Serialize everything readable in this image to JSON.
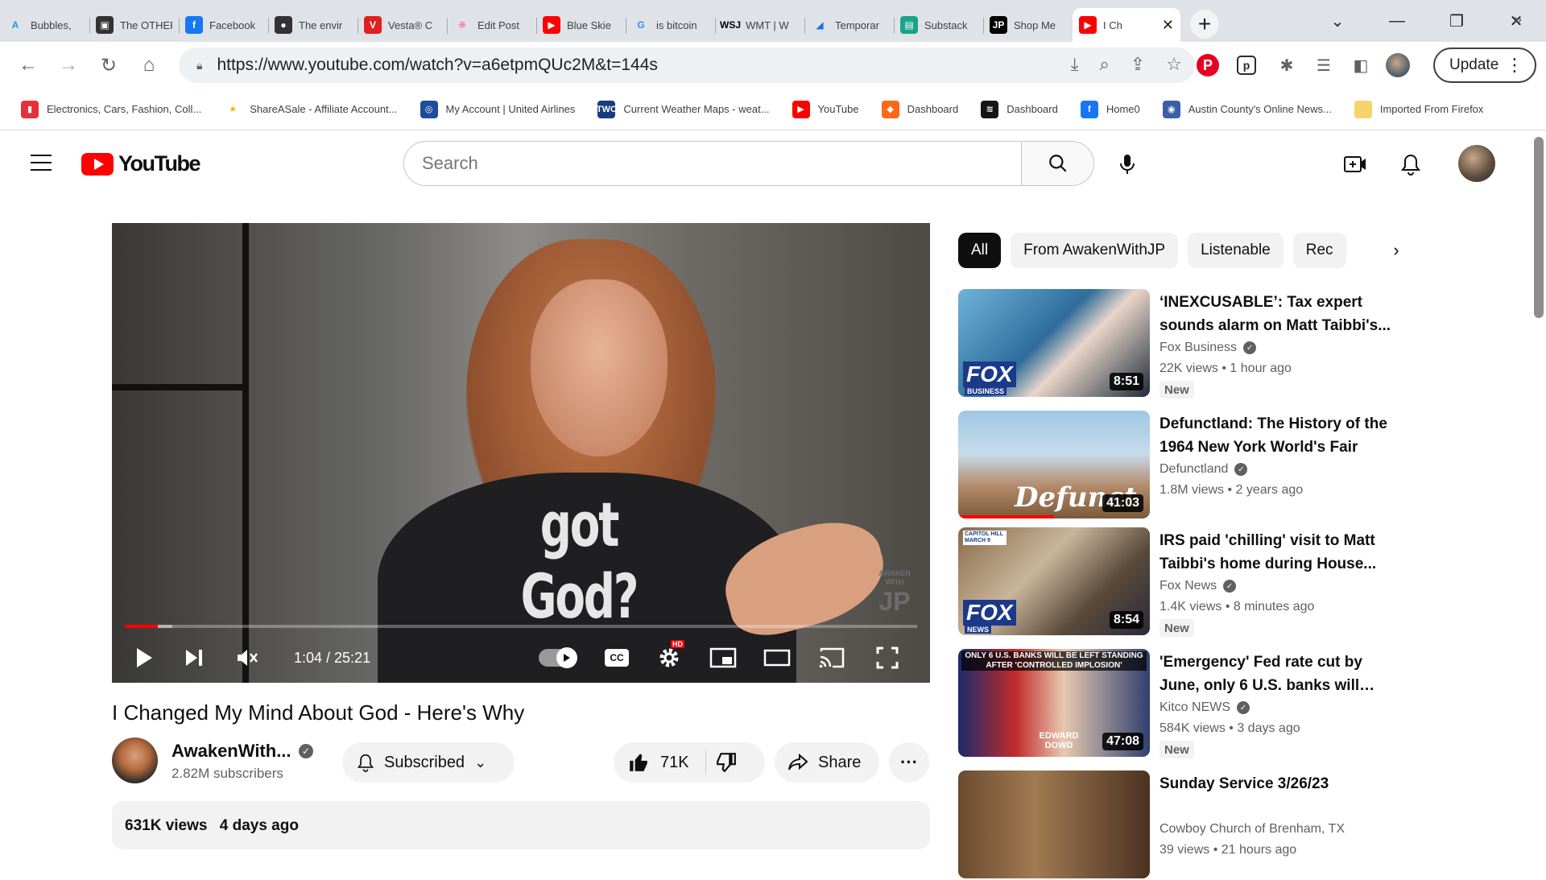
{
  "tabs": [
    {
      "title": "Bubbles,",
      "fav": "A",
      "color": "#1a9be0",
      "bg": "transparent"
    },
    {
      "title": "The OTHER",
      "fav": "▣",
      "color": "#ffffff",
      "bg": "#333333"
    },
    {
      "title": "Facebook",
      "fav": "f",
      "color": "#ffffff",
      "bg": "#1877f2"
    },
    {
      "title": "The envir",
      "fav": "●",
      "color": "#ffffff",
      "bg": "#333333"
    },
    {
      "title": "Vesta® C",
      "fav": "V",
      "color": "#ffffff",
      "bg": "#e02020"
    },
    {
      "title": "Edit Post",
      "fav": "❋",
      "color": "#ff6fb0",
      "bg": "transparent"
    },
    {
      "title": "Blue Skie",
      "fav": "▶",
      "color": "#ffffff",
      "bg": "#ff0000"
    },
    {
      "title": "is bitcoin",
      "fav": "G",
      "color": "#4285f4",
      "bg": "transparent"
    },
    {
      "title": "WMT | W",
      "fav": "WSJ",
      "color": "#000000",
      "bg": "transparent"
    },
    {
      "title": "Temporar",
      "fav": "◢",
      "color": "#1a73e8",
      "bg": "transparent"
    },
    {
      "title": "Substack",
      "fav": "▤",
      "color": "#ffffff",
      "bg": "#1aa38a"
    },
    {
      "title": "Shop Me",
      "fav": "JP",
      "color": "#ffffff",
      "bg": "#000000"
    },
    {
      "title": "I Ch",
      "fav": "▶",
      "color": "#ffffff",
      "bg": "#ff0000",
      "active": true
    }
  ],
  "address": {
    "url": "https://www.youtube.com/watch?v=a6etpmQUc2M&t=144s",
    "update_label": "Update"
  },
  "bookmarks": [
    {
      "label": "Electronics, Cars, Fashion, Coll...",
      "fav": "▮",
      "color": "#ffffff",
      "bg": "#e53238"
    },
    {
      "label": "ShareASale - Affiliate Account...",
      "fav": "★",
      "color": "#f6b40e",
      "bg": "transparent"
    },
    {
      "label": "My Account | United Airlines",
      "fav": "◎",
      "color": "#ffffff",
      "bg": "#1f4c9c"
    },
    {
      "label": "Current Weather Maps - weat...",
      "fav": "TWC",
      "color": "#ffffff",
      "bg": "#1a3a80"
    },
    {
      "label": "YouTube",
      "fav": "▶",
      "color": "#ffffff",
      "bg": "#ff0000"
    },
    {
      "label": "Dashboard",
      "fav": "◆",
      "color": "#ffffff",
      "bg": "#ff6719"
    },
    {
      "label": "Dashboard",
      "fav": "≋",
      "color": "#ffffff",
      "bg": "#191414"
    },
    {
      "label": "Home0",
      "fav": "f",
      "color": "#ffffff",
      "bg": "#1877f2"
    },
    {
      "label": "Austin County's Online News...",
      "fav": "◉",
      "color": "#ffffff",
      "bg": "#3a5ea8"
    },
    {
      "label": "Imported From Firefox",
      "fav": "▭",
      "color": "#f6d36b",
      "bg": "#f6d36b"
    }
  ],
  "youtube": {
    "logo_text": "YouTube",
    "search_placeholder": "Search"
  },
  "player": {
    "time_current": "1:04",
    "time_total": "25:21",
    "time_display": "1:04 / 25:21",
    "shirt_text": "got God?",
    "watermark_top": "AWAKEN WITH",
    "watermark_logo": "JP",
    "progress_fraction": 0.0421,
    "loaded_fraction": 0.06,
    "hd_badge": "HD",
    "cc_label": "CC"
  },
  "video": {
    "title": "I Changed My Mind About God - Here's Why",
    "channel": "AwakenWith...",
    "subscribers": "2.82M subscribers",
    "subscribed_label": "Subscribed",
    "likes": "71K",
    "share_label": "Share",
    "views": "631K views",
    "age": "4 days ago"
  },
  "chips": [
    {
      "label": "All",
      "active": true
    },
    {
      "label": "From AwakenWithJP"
    },
    {
      "label": "Listenable"
    },
    {
      "label": "Rec"
    }
  ],
  "recommendations": [
    {
      "title": "‘INEXCUSABLE’: Tax expert sounds alarm on Matt Taibbi's...",
      "channel": "Fox Business",
      "views": "22K views",
      "age": "1 hour ago",
      "duration": "8:51",
      "is_new": true,
      "new_label": "New",
      "thumb_text": "FOX",
      "thumb_sub": "BUSINESS",
      "thumb_bg": "linear-gradient(135deg, #6fb3d8 0%, #2f6d9c 45%, #e9d6c8 60%, #1d2a3a 100%)"
    },
    {
      "title": "Defunctland: The History of the 1964 New York World's Fair",
      "channel": "Defunctland",
      "views": "1.8M views",
      "age": "2 years ago",
      "duration": "41:03",
      "is_new": false,
      "thumb_text": "Defunct",
      "thumb_sub": "",
      "thumb_bg": "linear-gradient(180deg, #9ec7e6 0%, #c7dcea 40%, #b38a6a 70%, #7a5a3a 100%)",
      "watched_fraction": 0.5
    },
    {
      "title": "IRS paid 'chilling' visit to Matt Taibbi's home during House...",
      "channel": "Fox News",
      "views": "1.4K views",
      "age": "8 minutes ago",
      "duration": "8:54",
      "is_new": true,
      "new_label": "New",
      "thumb_text": "FOX",
      "thumb_sub": "NEWS",
      "thumb_bg": "linear-gradient(135deg, #8a6a4a 0%, #c9b59a 40%, #5a4a3a 70%, #2a2a3a 100%)",
      "thumb_corner": "CAPITOL HILL MARCH 9"
    },
    {
      "title": "'Emergency' Fed rate cut by June, only 6 U.S. banks will be...",
      "channel": "Kitco NEWS",
      "views": "584K views",
      "age": "3 days ago",
      "duration": "47:08",
      "is_new": true,
      "new_label": "New",
      "thumb_text": "EDWARD DOWD",
      "thumb_sub": "ONLY 6 U.S. BANKS WILL BE LEFT STANDING AFTER 'CONTROLLED IMPLOSION'",
      "thumb_bg": "linear-gradient(90deg, #1b2a6b 0%, #c22a2a 30%, #e8c9b0 55%, #2f3f6f 100%)"
    },
    {
      "title": "Sunday Service 3/26/23",
      "channel": "Cowboy Church of Brenham, TX",
      "views": "39 views",
      "age": "21 hours ago",
      "duration": "",
      "is_new": false,
      "verified": false,
      "thumb_text": "",
      "thumb_sub": "",
      "thumb_bg": "linear-gradient(90deg, #6b4a2e 0%, #a07a52 40%, #4a3220 100%)"
    }
  ]
}
